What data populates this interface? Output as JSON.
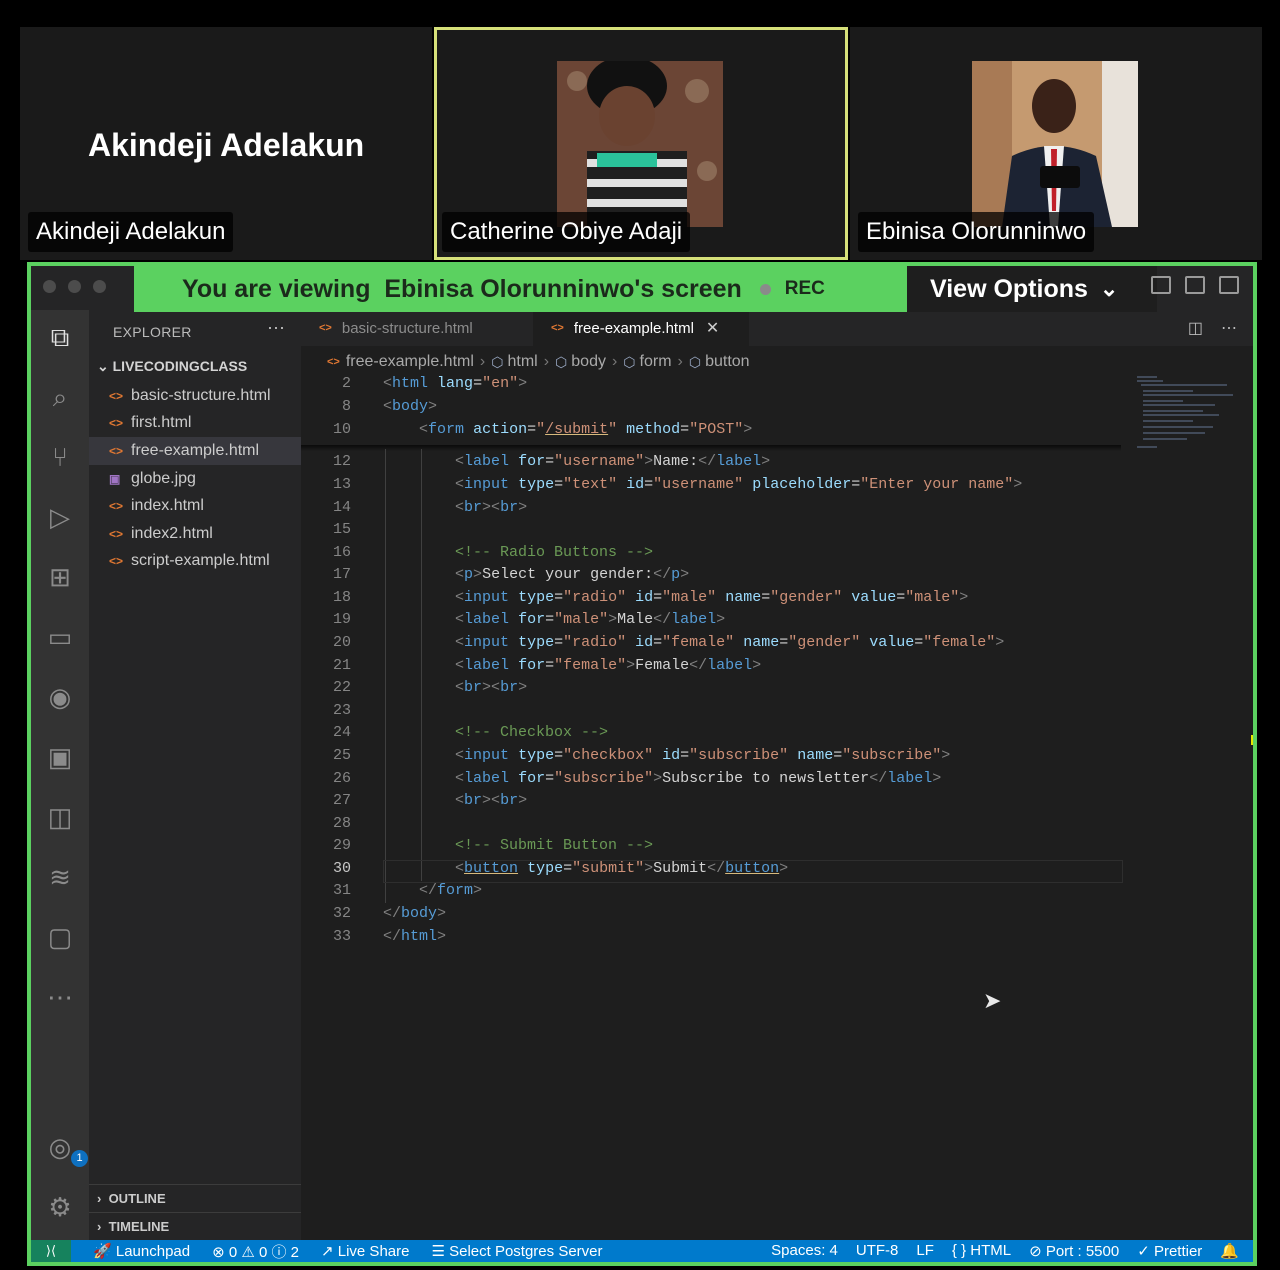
{
  "participants": [
    {
      "name": "Akindeji Adelakun",
      "display_name": "Akindeji Adelakun"
    },
    {
      "name": "Catherine Obiye Adaji"
    },
    {
      "name": "Ebinisa Olorunninwo"
    }
  ],
  "share_banner": {
    "viewing_text": "You are viewing  Ebinisa Olorunninwo's screen",
    "rec": "REC",
    "view_options": "View Options",
    "color": "#5bd160"
  },
  "explorer": {
    "title": "EXPLORER",
    "folder": "LIVECODINGCLASS",
    "files": [
      {
        "name": "basic-structure.html",
        "icon": "<>"
      },
      {
        "name": "first.html",
        "icon": "<>"
      },
      {
        "name": "free-example.html",
        "icon": "<>"
      },
      {
        "name": "globe.jpg",
        "icon": "▣"
      },
      {
        "name": "index.html",
        "icon": "<>"
      },
      {
        "name": "index2.html",
        "icon": "<>"
      },
      {
        "name": "script-example.html",
        "icon": "<>"
      }
    ],
    "outline": "OUTLINE",
    "timeline": "TIMELINE"
  },
  "tabs": [
    {
      "label": "basic-structure.html",
      "icon": "<>"
    },
    {
      "label": "free-example.html",
      "icon": "<>",
      "close": "✕"
    }
  ],
  "breadcrumb": [
    "free-example.html",
    "html",
    "body",
    "form",
    "button"
  ],
  "line_numbers": [
    "2",
    "8",
    "10",
    "12",
    "13",
    "14",
    "15",
    "16",
    "17",
    "18",
    "19",
    "20",
    "21",
    "22",
    "23",
    "24",
    "25",
    "26",
    "27",
    "28",
    "29",
    "30",
    "31",
    "32",
    "33"
  ],
  "status": {
    "launchpad": "Launchpad",
    "problems": "⊗ 0 ⚠ 0 ⓘ 2",
    "live_share": "Live Share",
    "postgres": "Select Postgres Server",
    "spaces": "Spaces: 4",
    "encoding": "UTF-8",
    "eol": "LF",
    "language": "{ } HTML",
    "port": "⊘ Port : 5500",
    "prettier": "✓ Prettier"
  },
  "account_badge": "1",
  "colors": {
    "accent": "#007acc",
    "string": "#ce9178",
    "tag": "#569cd6",
    "attr": "#9cdcfe",
    "comment": "#6a9955"
  }
}
